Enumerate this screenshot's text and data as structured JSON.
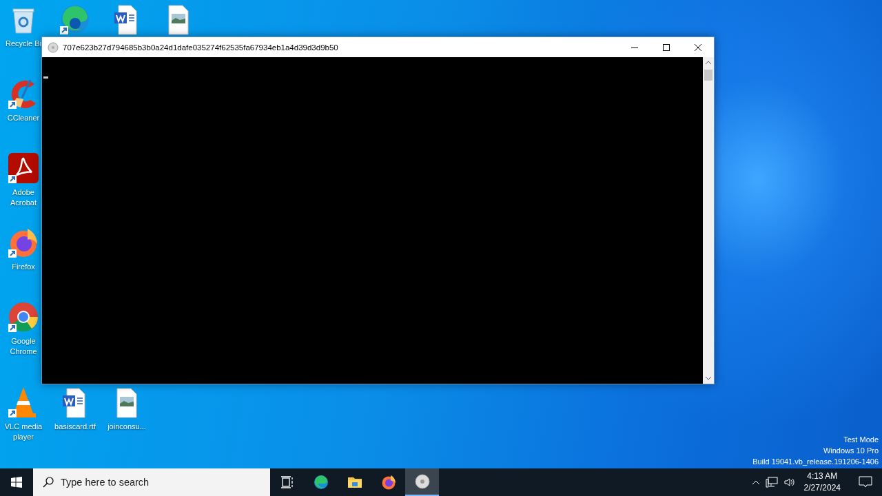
{
  "desktop_icons": [
    {
      "kind": "recycle",
      "label": "Recycle Bi",
      "shortcut": false
    },
    {
      "kind": "edge",
      "shortcut": true
    },
    {
      "kind": "word",
      "shortcut": false
    },
    {
      "kind": "image",
      "shortcut": false
    },
    {
      "kind": "ccleaner",
      "label": "CCleaner",
      "shortcut": true
    },
    {
      "kind": "acrobat",
      "label": "Adobe Acrobat",
      "shortcut": true
    },
    {
      "kind": "firefox",
      "label": "Firefox",
      "shortcut": true
    },
    {
      "kind": "chrome",
      "label": "Google Chrome",
      "shortcut": true
    },
    {
      "kind": "vlc",
      "label": "VLC media player",
      "shortcut": true
    },
    {
      "kind": "word",
      "label": "basiscard.rtf",
      "shortcut": false
    },
    {
      "kind": "image",
      "label": "joinconsu...",
      "shortcut": false
    }
  ],
  "window": {
    "title": "707e623b27d794685b3b0a24d1dafe035274f62535fa67934eb1a4d39d3d9b50"
  },
  "desktop_notice": [
    "Test Mode",
    "Windows 10 Pro",
    "Build 19041.vb_release.191206-1406"
  ],
  "taskbar": {
    "search": {
      "placeholder": "Type here to search"
    },
    "apps": [
      {
        "kind": "taskview",
        "selected": false
      },
      {
        "kind": "edge",
        "selected": false
      },
      {
        "kind": "explorer",
        "selected": false
      },
      {
        "kind": "firefox",
        "selected": false
      },
      {
        "kind": "disc",
        "selected": true
      }
    ],
    "time": "4:13 AM",
    "date": "2/27/2024"
  }
}
